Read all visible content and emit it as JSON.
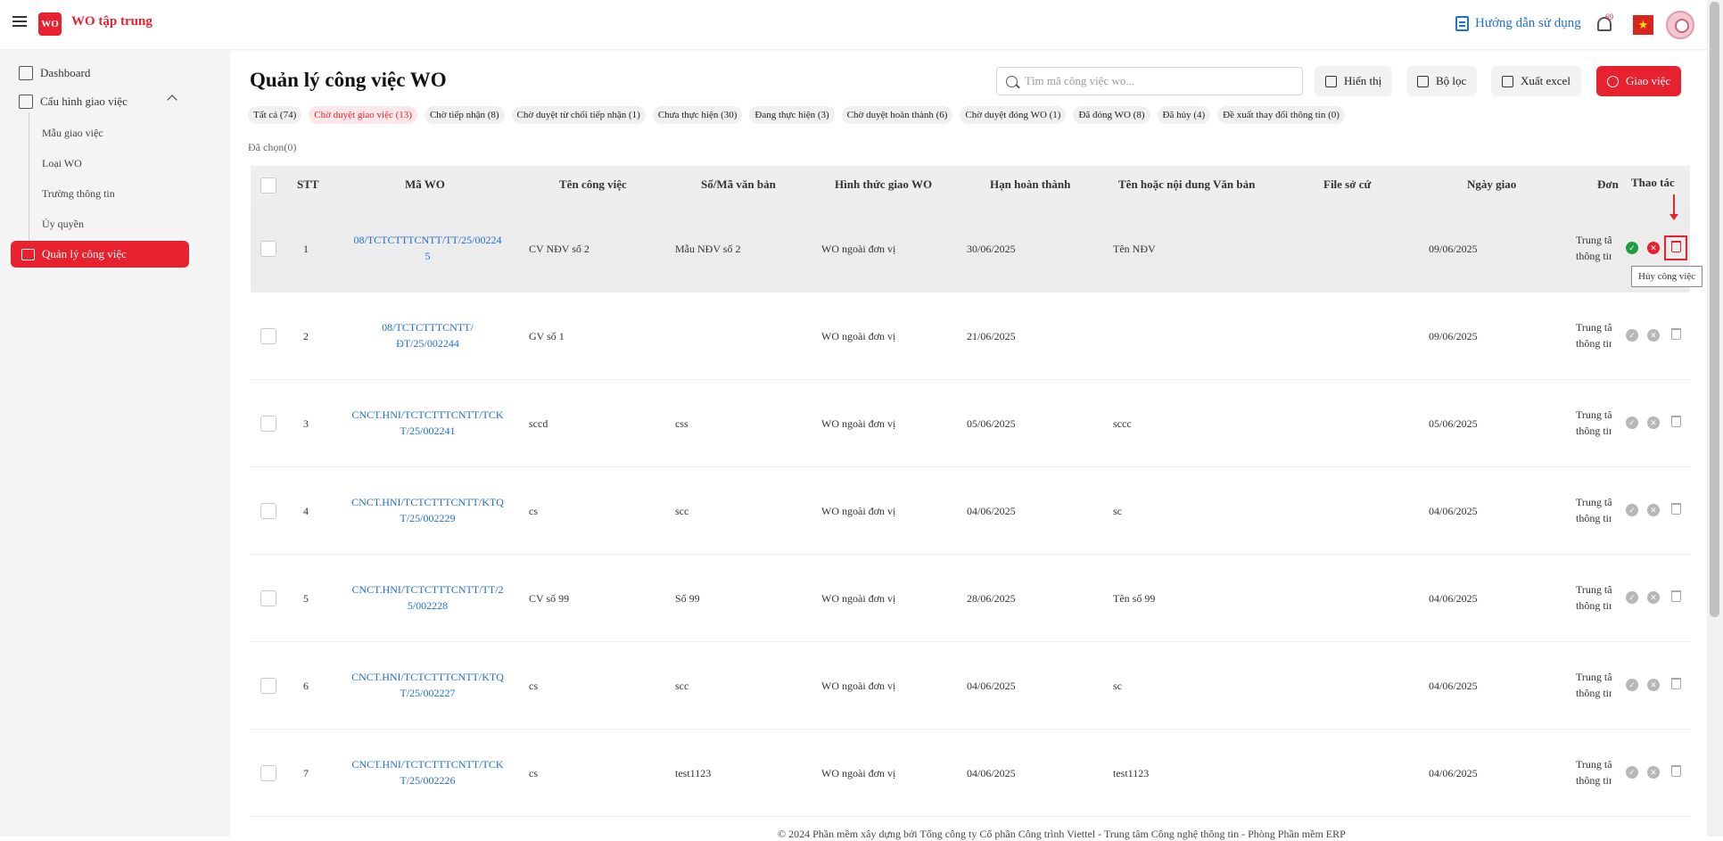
{
  "header": {
    "app_title": "WO tập trung",
    "logo_text": "WO",
    "help_label": "Hướng dẫn sử dụng",
    "notification_count": "69",
    "flag_star": "★"
  },
  "sidebar": {
    "dashboard": "Dashboard",
    "config_group": "Cấu hình giao việc",
    "sub_items": [
      "Mẫu giao việc",
      "Loại WO",
      "Trường thông tin",
      "Ủy quyền"
    ],
    "active_item": "Quản lý công việc"
  },
  "main": {
    "title": "Quản lý công việc WO",
    "search_placeholder": "Tìm mã công việc wo...",
    "buttons": {
      "display": "Hiển thị",
      "filter": "Bộ lọc",
      "export": "Xuất excel",
      "assign": "Giao việc"
    },
    "tabs": [
      "Tất cả (74)",
      "Chờ duyệt giao việc (13)",
      "Chờ tiếp nhận (8)",
      "Chờ duyệt từ chối tiếp nhận (1)",
      "Chưa thực hiện (30)",
      "Đang thực hiện (3)",
      "Chờ duyệt hoàn thành (6)",
      "Chờ duyệt đóng WO (1)",
      "Đã đóng WO (8)",
      "Đã hủy (4)",
      "Đề xuất thay đổi thông tin (0)"
    ],
    "active_tab_index": 1,
    "selected_count": "Đã chọn(0)"
  },
  "table": {
    "columns": [
      "STT",
      "Mã WO",
      "Tên công việc",
      "Số/Mã văn bản",
      "Hình thức giao WO",
      "Hạn hoàn thành",
      "Tên hoặc nội dung Văn bản",
      "File sở cứ",
      "Ngày giao",
      "Đơn",
      "Thao tác"
    ],
    "rows": [
      {
        "stt": "1",
        "code_1": "08/TCTCTTTCNTT/TT/25/00224",
        "code_2": "5",
        "name": "CV NĐV số 2",
        "doc_no": "Mẫu NĐV số 2",
        "form": "WO ngoài đơn vị",
        "deadline": "30/06/2025",
        "doc_name": "Tên NĐV",
        "file": "",
        "assigned": "09/06/2025",
        "unit_1": "Trung tâm",
        "unit_2": "thông tin"
      },
      {
        "stt": "2",
        "code_1": "08/TCTCTTTCNTT/",
        "code_2": "ĐT/25/002244",
        "name": "GV số 1",
        "doc_no": "",
        "form": "WO ngoài đơn vị",
        "deadline": "21/06/2025",
        "doc_name": "",
        "file": "",
        "assigned": "09/06/2025",
        "unit_1": "Trung tâm",
        "unit_2": "thông tin"
      },
      {
        "stt": "3",
        "code_1": "CNCT.HNI/TCTCTTTCNTT/TCK",
        "code_2": "T/25/002241",
        "name": "sccd",
        "doc_no": "css",
        "form": "WO ngoài đơn vị",
        "deadline": "05/06/2025",
        "doc_name": "sccc",
        "file": "",
        "assigned": "05/06/2025",
        "unit_1": "Trung tâm",
        "unit_2": "thông tin"
      },
      {
        "stt": "4",
        "code_1": "CNCT.HNI/TCTCTTTCNTT/KTQ",
        "code_2": "T/25/002229",
        "name": "cs",
        "doc_no": "scc",
        "form": "WO ngoài đơn vị",
        "deadline": "04/06/2025",
        "doc_name": "sc",
        "file": "",
        "assigned": "04/06/2025",
        "unit_1": "Trung tâm",
        "unit_2": "thông tin"
      },
      {
        "stt": "5",
        "code_1": "CNCT.HNI/TCTCTTTCNTT/TT/2",
        "code_2": "5/002228",
        "name": "CV số 99",
        "doc_no": "Số 99",
        "form": "WO ngoài đơn vị",
        "deadline": "28/06/2025",
        "doc_name": "Tên số 99",
        "file": "",
        "assigned": "04/06/2025",
        "unit_1": "Trung tâm",
        "unit_2": "thông tin"
      },
      {
        "stt": "6",
        "code_1": "CNCT.HNI/TCTCTTTCNTT/KTQ",
        "code_2": "T/25/002227",
        "name": "cs",
        "doc_no": "scc",
        "form": "WO ngoài đơn vị",
        "deadline": "04/06/2025",
        "doc_name": "sc",
        "file": "",
        "assigned": "04/06/2025",
        "unit_1": "Trung tâm",
        "unit_2": "thông tin"
      },
      {
        "stt": "7",
        "code_1": "CNCT.HNI/TCTCTTTCNTT/TCK",
        "code_2": "T/25/002226",
        "name": "cs",
        "doc_no": "test1123",
        "form": "WO ngoài đơn vị",
        "deadline": "04/06/2025",
        "doc_name": "test1123",
        "file": "",
        "assigned": "04/06/2025",
        "unit_1": "Trung tâm",
        "unit_2": "thông tin"
      }
    ]
  },
  "tooltip": "Hủy công việc",
  "footer": "© 2024 Phần mềm xây dựng bởi Tổng công ty Cổ phần Công trình Viettel - Trung tâm Công nghệ thông tin - Phòng Phần mềm ERP",
  "colors": {
    "brand": "#e8212f",
    "link": "#1d6fd6",
    "approve": "#1e9e3e"
  }
}
